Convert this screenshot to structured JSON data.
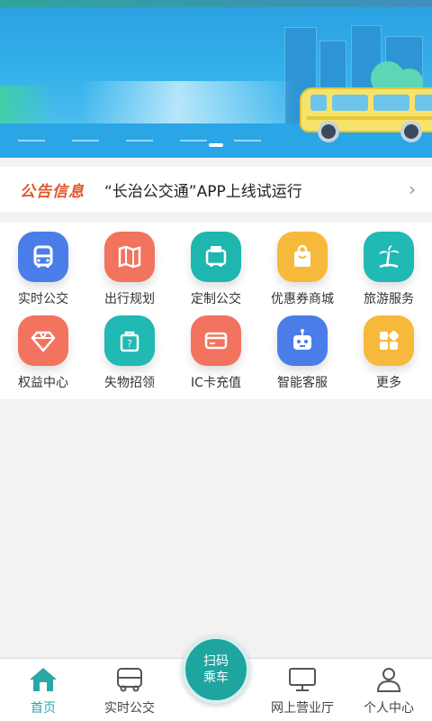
{
  "notice": {
    "badge": "公告信息",
    "text": "“长治公交通”APP上线试运行"
  },
  "services": [
    {
      "label": "实时公交",
      "icon": "bus-icon",
      "color": "#4b7de8"
    },
    {
      "label": "出行规划",
      "icon": "map-icon",
      "color": "#f2735e"
    },
    {
      "label": "定制公交",
      "icon": "custom-bus-icon",
      "color": "#1fb6b0"
    },
    {
      "label": "优惠券商城",
      "icon": "shopping-bag-icon",
      "color": "#f6b93b"
    },
    {
      "label": "旅游服务",
      "icon": "palm-tree-icon",
      "color": "#20b9b3"
    },
    {
      "label": "权益中心",
      "icon": "diamond-icon",
      "color": "#f2735e"
    },
    {
      "label": "失物招领",
      "icon": "lost-found-icon",
      "color": "#20b9b3"
    },
    {
      "label": "IC卡充值",
      "icon": "card-icon",
      "color": "#f2735e"
    },
    {
      "label": "智能客服",
      "icon": "robot-icon",
      "color": "#4b7de8"
    },
    {
      "label": "更多",
      "icon": "more-icon",
      "color": "#f6b93b"
    }
  ],
  "nav": {
    "home": "首页",
    "realtime": "实时公交",
    "scan_line1": "扫码",
    "scan_line2": "乘车",
    "online_hall": "网上营业厅",
    "profile": "个人中心"
  },
  "colors": {
    "accent": "#2aa8a8",
    "notice_badge": "#e0582a"
  }
}
